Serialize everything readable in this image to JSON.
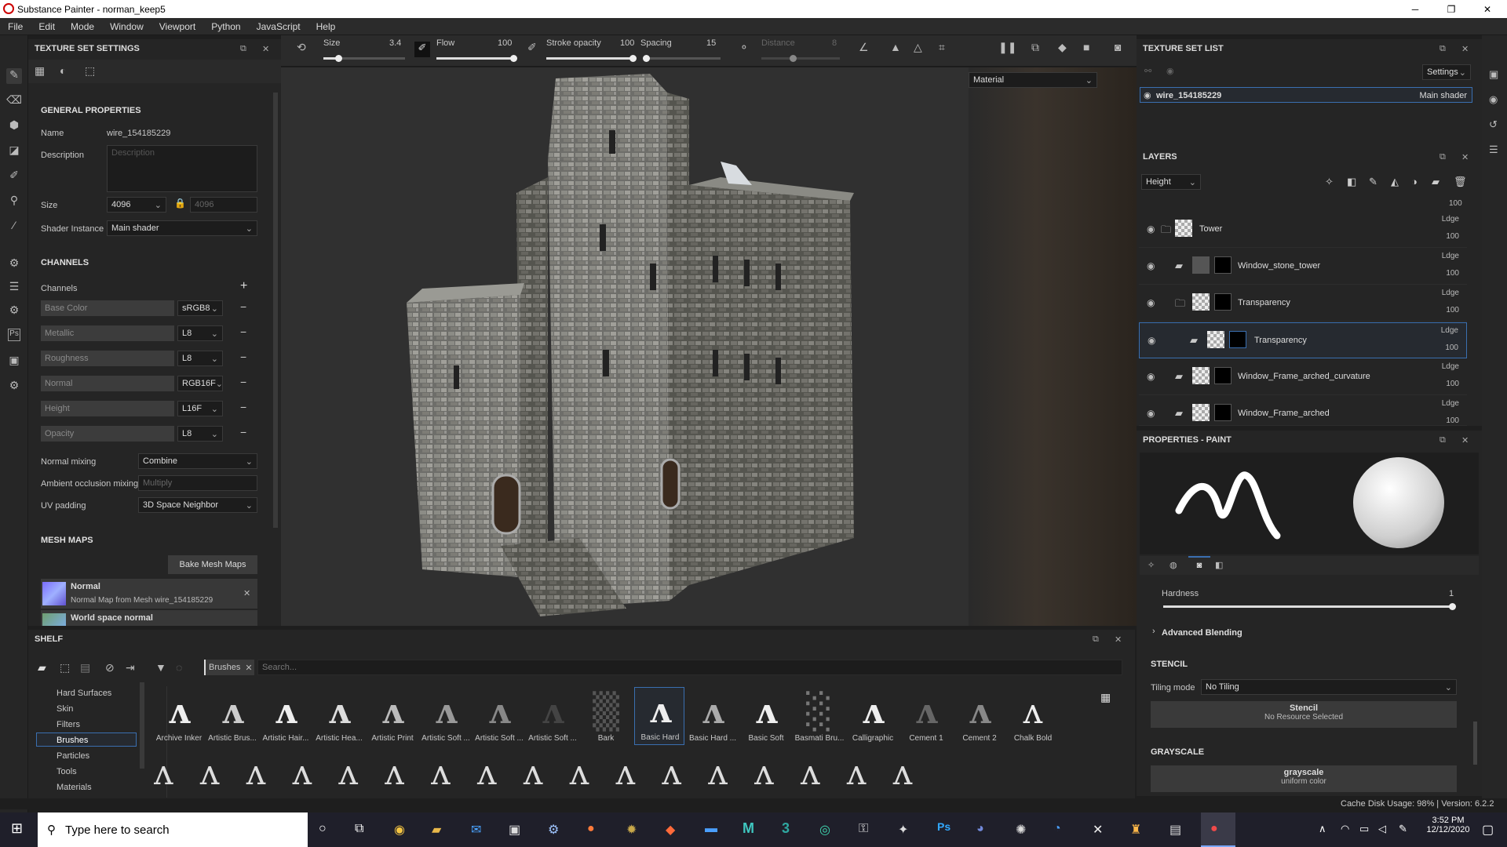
{
  "window": {
    "title": "Substance Painter - norman_keep5",
    "minimize": "─",
    "maximize": "❐",
    "close": "✕"
  },
  "menu": [
    "File",
    "Edit",
    "Mode",
    "Window",
    "Viewport",
    "Python",
    "JavaScript",
    "Help"
  ],
  "toolbar": {
    "size_label": "Size",
    "size_value": "3.4",
    "size_fraction": 0.18,
    "flow_label": "Flow",
    "flow_value": "100",
    "flow_fraction": 1.0,
    "stroke_label": "Stroke opacity",
    "stroke_value": "100",
    "stroke_fraction": 1.0,
    "spacing_label": "Spacing",
    "spacing_value": "15",
    "spacing_fraction": 0.03,
    "distance_label": "Distance",
    "distance_value": "8",
    "distance_fraction": 0.4
  },
  "texture_set_settings": {
    "title": "TEXTURE SET SETTINGS",
    "general_title": "GENERAL PROPERTIES",
    "name_label": "Name",
    "name_value": "wire_154185229",
    "description_label": "Description",
    "description_placeholder": "Description",
    "size_label": "Size",
    "size_value": "4096",
    "size_value2": "4096",
    "shader_label": "Shader Instance",
    "shader_value": "Main shader",
    "channels_title": "CHANNELS",
    "channels_label": "Channels",
    "add": "+",
    "channels": [
      {
        "name": "Base Color",
        "format": "sRGB8"
      },
      {
        "name": "Metallic",
        "format": "L8"
      },
      {
        "name": "Roughness",
        "format": "L8"
      },
      {
        "name": "Normal",
        "format": "RGB16F"
      },
      {
        "name": "Height",
        "format": "L16F"
      },
      {
        "name": "Opacity",
        "format": "L8"
      }
    ],
    "normal_mixing_label": "Normal mixing",
    "normal_mixing_value": "Combine",
    "ao_mixing_label": "Ambient occlusion mixing",
    "ao_mixing_value": "Multiply",
    "uv_padding_label": "UV padding",
    "uv_padding_value": "3D Space Neighbor",
    "mesh_maps_title": "MESH MAPS",
    "bake_button": "Bake Mesh Maps",
    "mesh_maps": [
      {
        "name": "Normal",
        "desc": "Normal Map from Mesh wire_154185229"
      },
      {
        "name": "World space normal",
        "desc": ""
      }
    ]
  },
  "viewport": {
    "mode": "Material"
  },
  "texture_set_list": {
    "title": "TEXTURE SET LIST",
    "settings": "Settings",
    "item_name": "wire_154185229",
    "item_shader": "Main shader"
  },
  "layers": {
    "title": "LAYERS",
    "channel": "Height",
    "top_opacity": "100",
    "rows": [
      {
        "name": "Tower",
        "blend": "Ldge",
        "opacity": "100"
      },
      {
        "name": "Window_stone_tower",
        "blend": "Ldge",
        "opacity": "100"
      },
      {
        "name": "Transparency",
        "blend": "Ldge",
        "opacity": "100"
      },
      {
        "name": "Transparency",
        "blend": "Ldge",
        "opacity": "100"
      },
      {
        "name": "Window_Frame_arched_curvature",
        "blend": "Ldge",
        "opacity": "100"
      },
      {
        "name": "Window_Frame_arched",
        "blend": "Ldge",
        "opacity": "100"
      }
    ]
  },
  "properties": {
    "title": "PROPERTIES - PAINT",
    "hardness_label": "Hardness",
    "hardness_value": "1",
    "hardness_fraction": 1.0,
    "advanced_blending": "Advanced Blending",
    "stencil_title": "STENCIL",
    "tiling_label": "Tiling mode",
    "tiling_value": "No Tiling",
    "stencil_button": "Stencil",
    "stencil_sub": "No Resource Selected",
    "grayscale_title": "GRAYSCALE",
    "grayscale_button": "grayscale",
    "grayscale_sub": "uniform color"
  },
  "shelf": {
    "title": "SHELF",
    "filter_tag": "Brushes",
    "search_placeholder": "Search...",
    "categories": [
      "Hard Surfaces",
      "Skin",
      "Filters",
      "Brushes",
      "Particles",
      "Tools",
      "Materials"
    ],
    "selected_category": "Brushes",
    "brushes": [
      "Archive Inker",
      "Artistic Brus...",
      "Artistic Hair...",
      "Artistic Hea...",
      "Artistic Print",
      "Artistic Soft ...",
      "Artistic Soft ...",
      "Artistic Soft ...",
      "Bark",
      "Basic Hard",
      "Basic Hard ...",
      "Basic Soft",
      "Basmati Bru...",
      "Calligraphic",
      "Cement 1",
      "Cement 2",
      "Chalk Bold"
    ]
  },
  "status": {
    "cache": "Cache Disk Usage:  98% | Version: 6.2.2"
  },
  "taskbar": {
    "search_placeholder": "Type here to search",
    "time": "3:52 PM",
    "date": "12/12/2020"
  },
  "colors": {
    "accent": "#3a6fb0",
    "panel": "#252525",
    "viewport": "#303030"
  }
}
